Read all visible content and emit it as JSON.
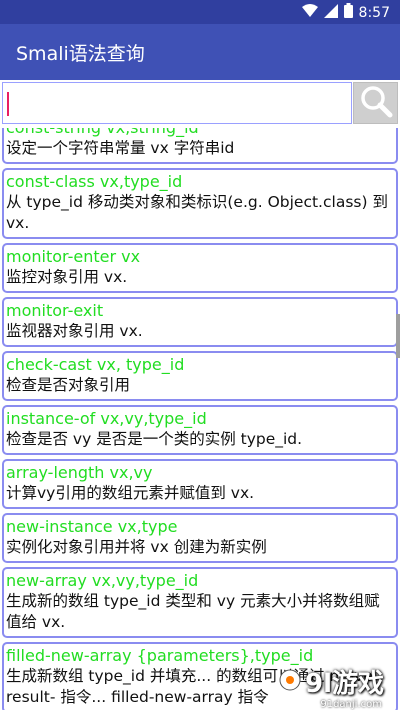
{
  "status_bar": {
    "time": "8:57",
    "icons": [
      "wifi-icon",
      "signal-icon",
      "battery-icon"
    ]
  },
  "app_bar": {
    "title": "Smali语法查询"
  },
  "search": {
    "value": "",
    "placeholder": "",
    "button_icon": "search-icon"
  },
  "items": [
    {
      "cmd": "const-string vx,string_id",
      "desc": "设定一个字符串常量 vx 字符串id"
    },
    {
      "cmd": "const-class vx,type_id",
      "desc": "从 type_id 移动类对象和类标识(e.g. Object.class) 到 vx."
    },
    {
      "cmd": "monitor-enter vx",
      "desc": "监控对象引用 vx."
    },
    {
      "cmd": "monitor-exit",
      "desc": "监视器对象引用 vx."
    },
    {
      "cmd": "check-cast vx, type_id",
      "desc": "检查是否对象引用"
    },
    {
      "cmd": "instance-of vx,vy,type_id",
      "desc": "检查是否 vy 是否是一个类的实例  type_id."
    },
    {
      "cmd": "array-length vx,vy",
      "desc": "计算vy引用的数组元素并赋值到 vx."
    },
    {
      "cmd": "new-instance vx,type",
      "desc": "实例化对象引用并将 vx 创建为新实例"
    },
    {
      "cmd": "new-array vx,vy,type_id",
      "desc": "生成新的数组 type_id 类型和 vy 元素大小并将数组赋值给 vx."
    },
    {
      "cmd": "filled-new-array {parameters},type_id",
      "desc": "生成新数组 type_id 并填充... 的数组可以通过 move-result- 指令... filled-new-array 指令"
    }
  ],
  "watermark": {
    "logo": "9l游戏",
    "url": "91danji.com",
    "overlay": "游戏"
  },
  "colors": {
    "status_bar": "#303f9f",
    "app_bar": "#3f51b5",
    "command_text": "#22dd22",
    "item_border": "#8a8cf0"
  }
}
